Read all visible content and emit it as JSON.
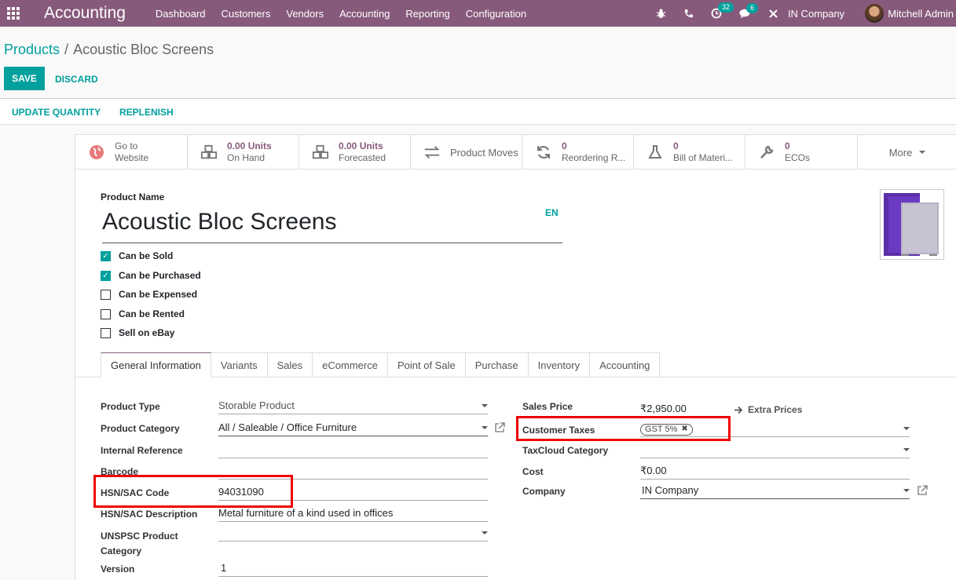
{
  "navbar": {
    "brand": "Accounting",
    "menu": [
      "Dashboard",
      "Customers",
      "Vendors",
      "Accounting",
      "Reporting",
      "Configuration"
    ],
    "activity_count": "32",
    "messages_count": "6",
    "company": "IN Company",
    "user": "Mitchell Admin"
  },
  "breadcrumb": {
    "parent": "Products",
    "current": "Acoustic Bloc Screens"
  },
  "actions": {
    "save": "SAVE",
    "discard": "DISCARD"
  },
  "statusbar": {
    "update_quantity": "UPDATE QUANTITY",
    "replenish": "REPLENISH"
  },
  "smart_buttons": [
    {
      "icon": "globe-icon",
      "line1": "Go to",
      "line2": "Website"
    },
    {
      "icon": "cubes-icon",
      "line1": "0.00 Units",
      "line2": "On Hand"
    },
    {
      "icon": "cubes-icon",
      "line1": "0.00 Units",
      "line2": "Forecasted"
    },
    {
      "icon": "exchange-icon",
      "line1": "Product Moves",
      "line2": ""
    },
    {
      "icon": "refresh-icon",
      "line1": "0",
      "line2": "Reordering R..."
    },
    {
      "icon": "flask-icon",
      "line1": "0",
      "line2": "Bill of Materi..."
    },
    {
      "icon": "wrench-icon",
      "line1": "0",
      "line2": "ECOs"
    }
  ],
  "more_label": "More",
  "product": {
    "name_label": "Product Name",
    "name": "Acoustic Bloc Screens",
    "lang": "EN"
  },
  "checkboxes": [
    {
      "label": "Can be Sold",
      "checked": true
    },
    {
      "label": "Can be Purchased",
      "checked": true
    },
    {
      "label": "Can be Expensed",
      "checked": false
    },
    {
      "label": "Can be Rented",
      "checked": false
    },
    {
      "label": "Sell on eBay",
      "checked": false
    }
  ],
  "tabs": [
    "General Information",
    "Variants",
    "Sales",
    "eCommerce",
    "Point of Sale",
    "Purchase",
    "Inventory",
    "Accounting"
  ],
  "left_fields": {
    "product_type": {
      "label": "Product Type",
      "value": "Storable Product"
    },
    "product_category": {
      "label": "Product Category",
      "value": "All / Saleable / Office Furniture"
    },
    "internal_reference": {
      "label": "Internal Reference",
      "value": ""
    },
    "barcode": {
      "label": "Barcode",
      "value": ""
    },
    "hsn_code": {
      "label": "HSN/SAC Code",
      "value": "94031090"
    },
    "hsn_description": {
      "label": "HSN/SAC Description",
      "value": "Metal furniture of a kind used in offices"
    },
    "unspsc_line1": "UNSPSC Product",
    "unspsc_line2": "Category",
    "version": {
      "label": "Version",
      "value": "1"
    }
  },
  "right_fields": {
    "sales_price": {
      "label": "Sales Price",
      "value": "₹2,950.00"
    },
    "extra_prices": "Extra Prices",
    "customer_taxes": {
      "label": "Customer Taxes",
      "tag": "GST 5%"
    },
    "taxcloud_category": {
      "label": "TaxCloud Category",
      "value": ""
    },
    "cost": {
      "label": "Cost",
      "value": "₹0.00"
    },
    "company": {
      "label": "Company",
      "value": "IN Company"
    }
  },
  "colors": {
    "navbar": "#875a7b",
    "accent": "#00a09d",
    "highlight": "#e00000"
  }
}
